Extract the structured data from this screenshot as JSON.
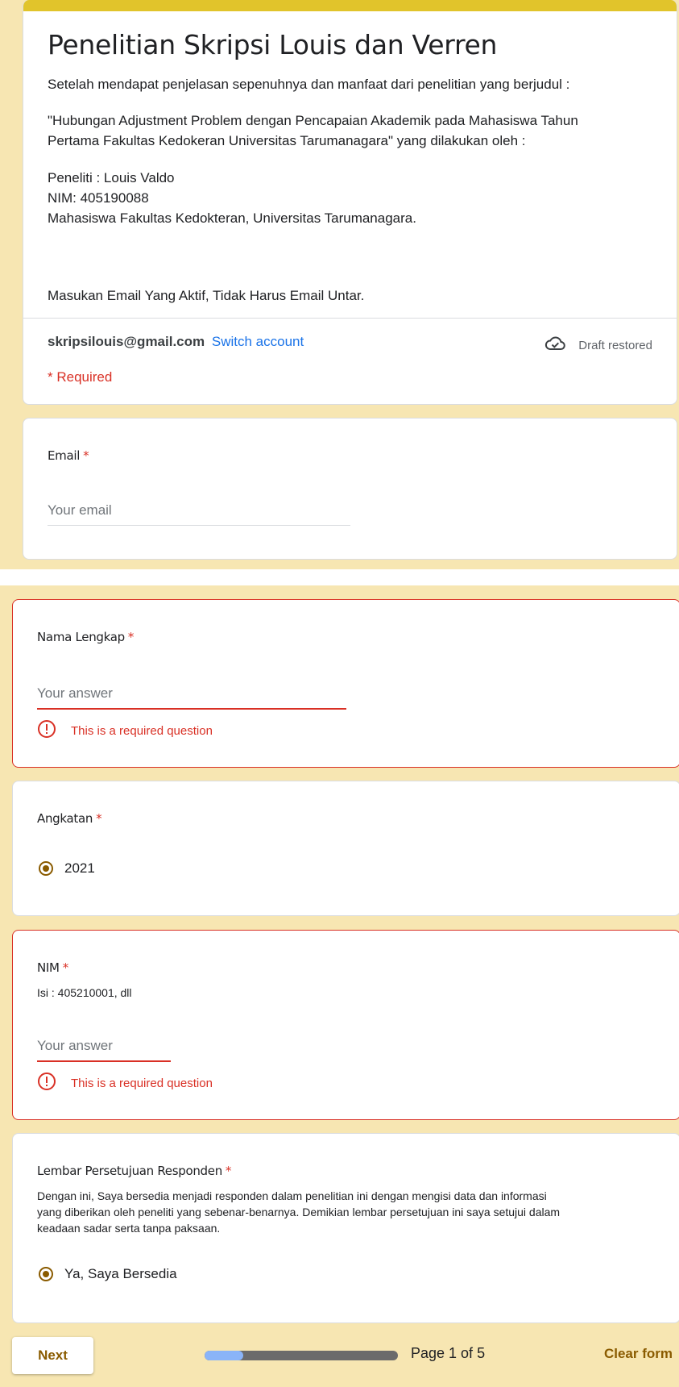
{
  "header": {
    "title": "Penelitian Skripsi Louis dan Verren",
    "description": [
      "Setelah mendapat penjelasan sepenuhnya dan manfaat dari penelitian yang berjudul :",
      "\"Hubungan Adjustment Problem dengan Pencapaian Akademik pada Mahasiswa Tahun",
      "Pertama Fakultas Kedokeran Universitas Tarumanagara\" yang dilakukan oleh :",
      "Peneliti : Louis Valdo",
      "NIM: 405190088",
      "Mahasiswa Fakultas Kedokteran, Universitas Tarumanagara.",
      "Masukan Email Yang Aktif, Tidak Harus Email Untar."
    ],
    "account_email": "skripsilouis@gmail.com",
    "switch_account": "Switch account",
    "draft_status": "Draft restored",
    "draft_icon": "cloud-done-icon",
    "required_note": "* Required"
  },
  "questions": {
    "email": {
      "label": "Email",
      "required": "*",
      "placeholder": "Your email"
    },
    "nama": {
      "label": "Nama Lengkap",
      "required": "*",
      "placeholder": "Your answer",
      "error": "This is a required question"
    },
    "angkatan": {
      "label": "Angkatan",
      "required": "*",
      "option": "2021"
    },
    "nim": {
      "label": "NIM",
      "required": "*",
      "help": "Isi : 405210001, dll",
      "placeholder": "Your answer",
      "error": "This is a required question"
    },
    "persetujuan": {
      "label": "Lembar Persetujuan Responden",
      "required": "*",
      "help_lines": [
        "Dengan ini, Saya bersedia menjadi responden dalam penelitian ini dengan mengisi data dan informasi",
        "yang diberikan oleh peneliti yang sebenar-benarnya. Demikian lembar persetujuan ini saya setujui dalam",
        "keadaan sadar serta tanpa paksaan."
      ],
      "option": "Ya, Saya Bersedia"
    }
  },
  "footer": {
    "next_label": "Next",
    "page_indicator": "Page 1 of 5",
    "progress_fraction": 0.2,
    "clear_label": "Clear form"
  },
  "colors": {
    "background": "#f7e6b2",
    "accent_bar": "#e1c42b",
    "brand": "#8a5b00",
    "error": "#d93025",
    "link": "#1a73e8"
  }
}
